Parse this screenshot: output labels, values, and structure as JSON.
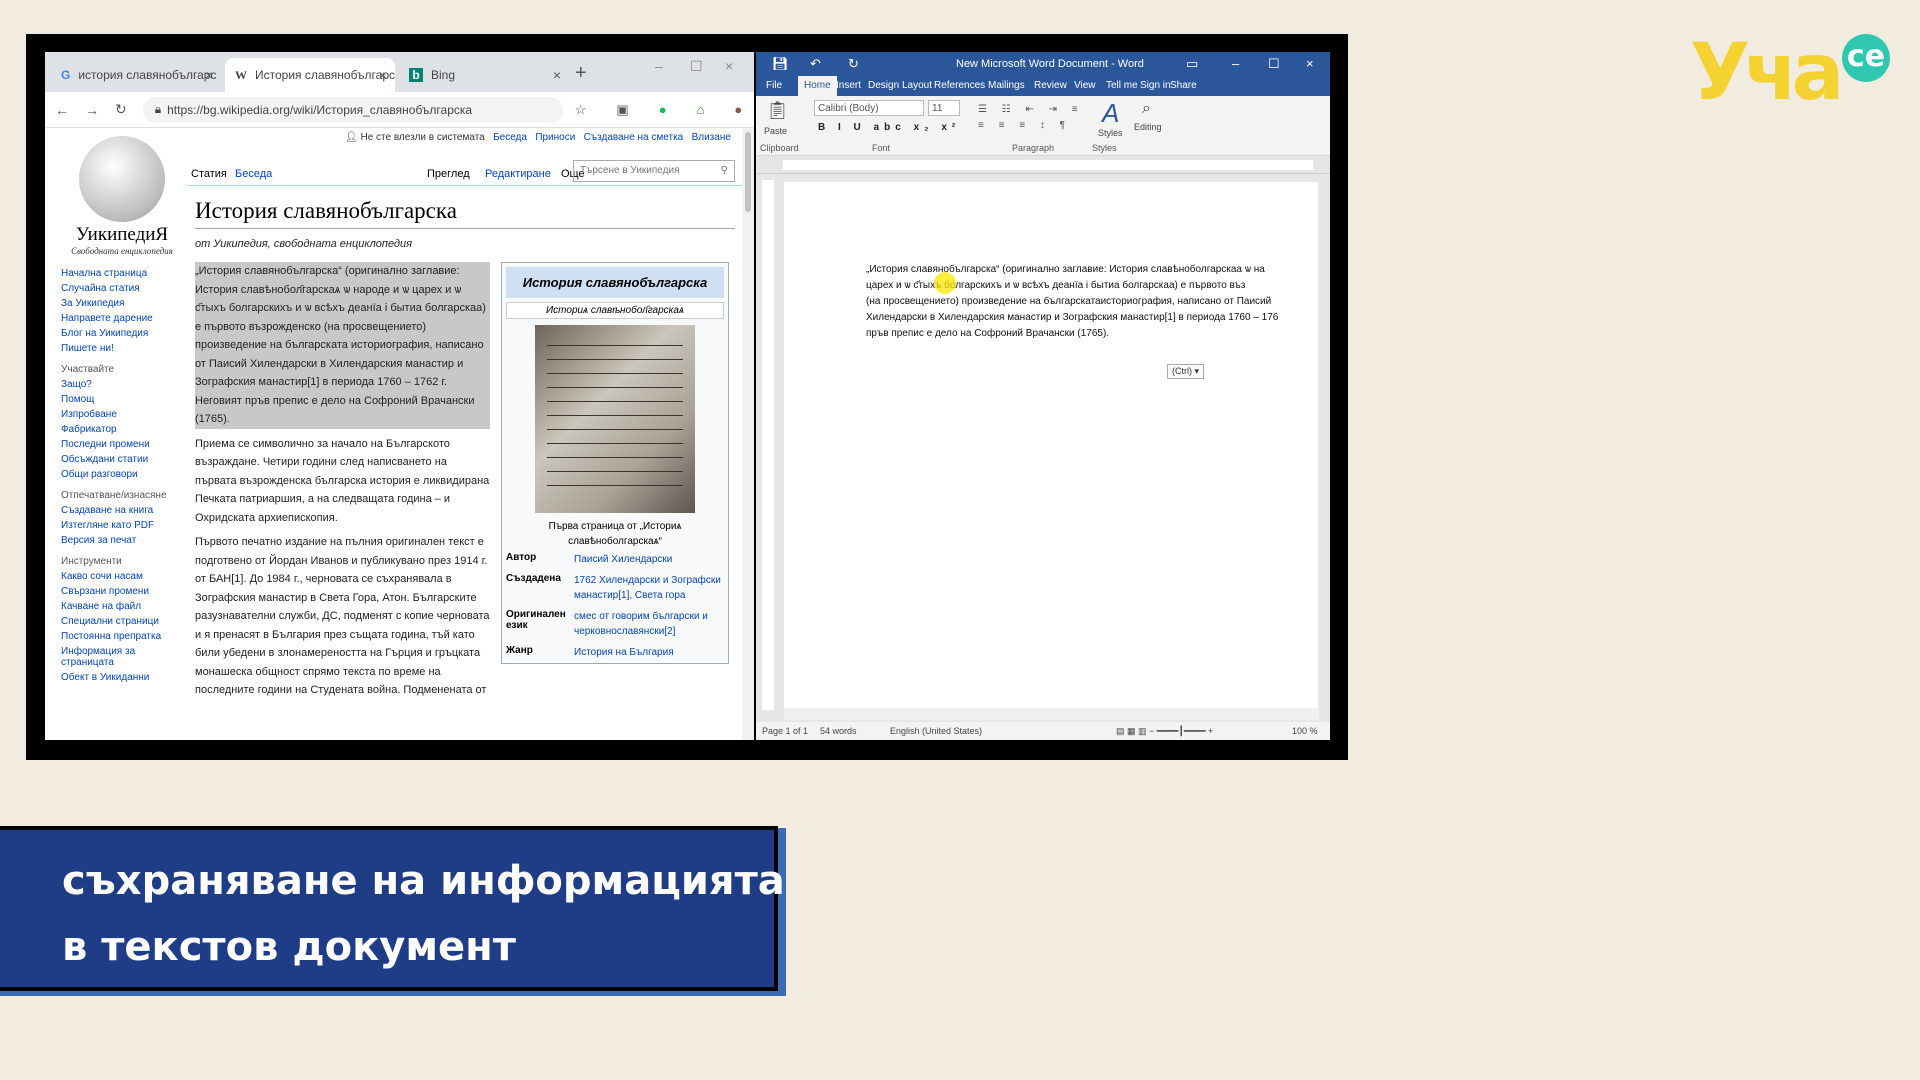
{
  "browser": {
    "tabs": [
      {
        "icon": "G",
        "label": "история славянобългарс"
      },
      {
        "icon": "W",
        "label": "История славянобългарс"
      },
      {
        "icon": "b",
        "label": "Bing"
      }
    ],
    "new_tab": "+",
    "url": "https://bg.wikipedia.org/wiki/История_славянобългарска"
  },
  "wiki": {
    "logo_name": "УикипедиЯ",
    "logo_sub": "Свободната енциклопедия",
    "top_links": {
      "not_logged": "Не сте влезли в системата",
      "talk": "Беседа",
      "contributions": "Приноси",
      "create": "Създаване на сметка",
      "login": "Влизане"
    },
    "tabs": {
      "article": "Статия",
      "talk": "Беседа",
      "read": "Преглед",
      "edit": "Редактиране",
      "more": "Още"
    },
    "search_placeholder": "Търсене в Уикипедия",
    "sidebar": [
      "Начална страница",
      "Случайна статия",
      "За Уикипедия",
      "Направете дарение",
      "Блог на Уикипедия",
      "Пишете ни!"
    ],
    "sidebar_participate_hd": "Участвайте",
    "sidebar_participate": [
      "Защо?",
      "Помощ",
      "Изпробване",
      "Фабрикатор",
      "Последни промени",
      "Обсъждани статии",
      "Общи разговори"
    ],
    "sidebar_print_hd": "Отпечатване/изнасяне",
    "sidebar_print": [
      "Създаване на книга",
      "Изтегляне като PDF",
      "Версия за печат"
    ],
    "sidebar_tools_hd": "Инструменти",
    "sidebar_tools": [
      "Какво сочи насам",
      "Свързани промени",
      "Качване на файл",
      "Специални страници",
      "Постоянна препратка",
      "Информация за страницата",
      "Обект в Уикиданни"
    ],
    "title": "История славянобългарска",
    "from": "от Уикипедия, свободната енциклопедия",
    "para1": "„История славянобългарска“ (оригинално заглавие: История славѣнобол҄гарскаѧ ѡ народе и ѡ царех и ѡ с҃тыхъ болгарскихъ и ѡ всѣхъ деанїа і бытиа болгарскаа) е първото възрожденско (на просвещението) произведение на българската историография, написано от Паисий Хилендарски в Хилендарския манастир и Зографския манастир[1] в периода 1760 – 1762 г. Неговият пръв препис е дело на Софроний Врачански (1765).",
    "para2": "Приема се символично за начало на Българското възраждане. Четири години след написването на първата възрожденска българска история е ликвидирана Печката патриаршия, а на следващата година – и Охридската архиепископия.",
    "para3": "Първото печатно издание на пълния оригинален текст е подготвено от Йордан Иванов и публикувано през 1914 г. от БАН[1]. До 1984 г., черновата се съхранявала в Зографския манастир в Света Гора, Атон. Българските разузнавателни служби, ДС, подменят с копие черновата и я пренасят в България през същата година, тъй като били убедени в злонамереността на Гърция и гръцката монашеска общност спрямо текста по време на последните години на Студената война. Подменената от",
    "infobox": {
      "title": "История славянобългарска",
      "subtitle": "Историѧ славѣнобол҄гарскаѧ",
      "caption": "Първа страница от „Историѧ славѣноболгарскаѧ“",
      "rows": [
        {
          "k": "Автор",
          "v": "Паисий Хилендарски"
        },
        {
          "k": "Създадена",
          "v": "1762 Хилендарски и Зографски манастир[1], Света гора"
        },
        {
          "k": "Оригинален език",
          "v": "смес от говорим български и черковнославянски[2]"
        },
        {
          "k": "Жанр",
          "v": "История на България"
        }
      ]
    }
  },
  "word": {
    "title": "New Microsoft Word Document - Word",
    "tabs": [
      "File",
      "Home",
      "Insert",
      "Design",
      "Layout",
      "References",
      "Mailings",
      "Review",
      "View",
      "Tell me",
      "Sign in",
      "Share"
    ],
    "font_name": "Calibri (Body)",
    "font_size": "11",
    "groups": {
      "clipboard": "Clipboard",
      "font": "Font",
      "paragraph": "Paragraph",
      "styles": "Styles",
      "editing": "Editing",
      "paste": "Paste"
    },
    "doc_lines": [
      "„История славянобългарска“ (оригинално заглавие: История славѣноболгарскаа ѡ на",
      "царех и ѡ с҃тыхъ болгарскихъ и ѡ всѣхъ деанїа і бытиа болгарскаа) е първото въз",
      "(на просвещението) произведение на българскатаисториография, написано от Паисий",
      "Хилендарски в Хилендарския манастир и Зографския манастир[1] в периода 1760 – 176",
      "пръв препис е дело на Софроний Врачански (1765)."
    ],
    "paste_ctrl": "(Ctrl) ▾",
    "status": {
      "page": "Page 1 of 1",
      "words": "54 words",
      "lang": "English (United States)",
      "zoom": "100 %"
    }
  },
  "brand": {
    "logo_main": "Уча",
    "logo_ce": "се"
  },
  "banner": {
    "line1": "съхраняване на информацията",
    "line2": "в текстов документ"
  }
}
